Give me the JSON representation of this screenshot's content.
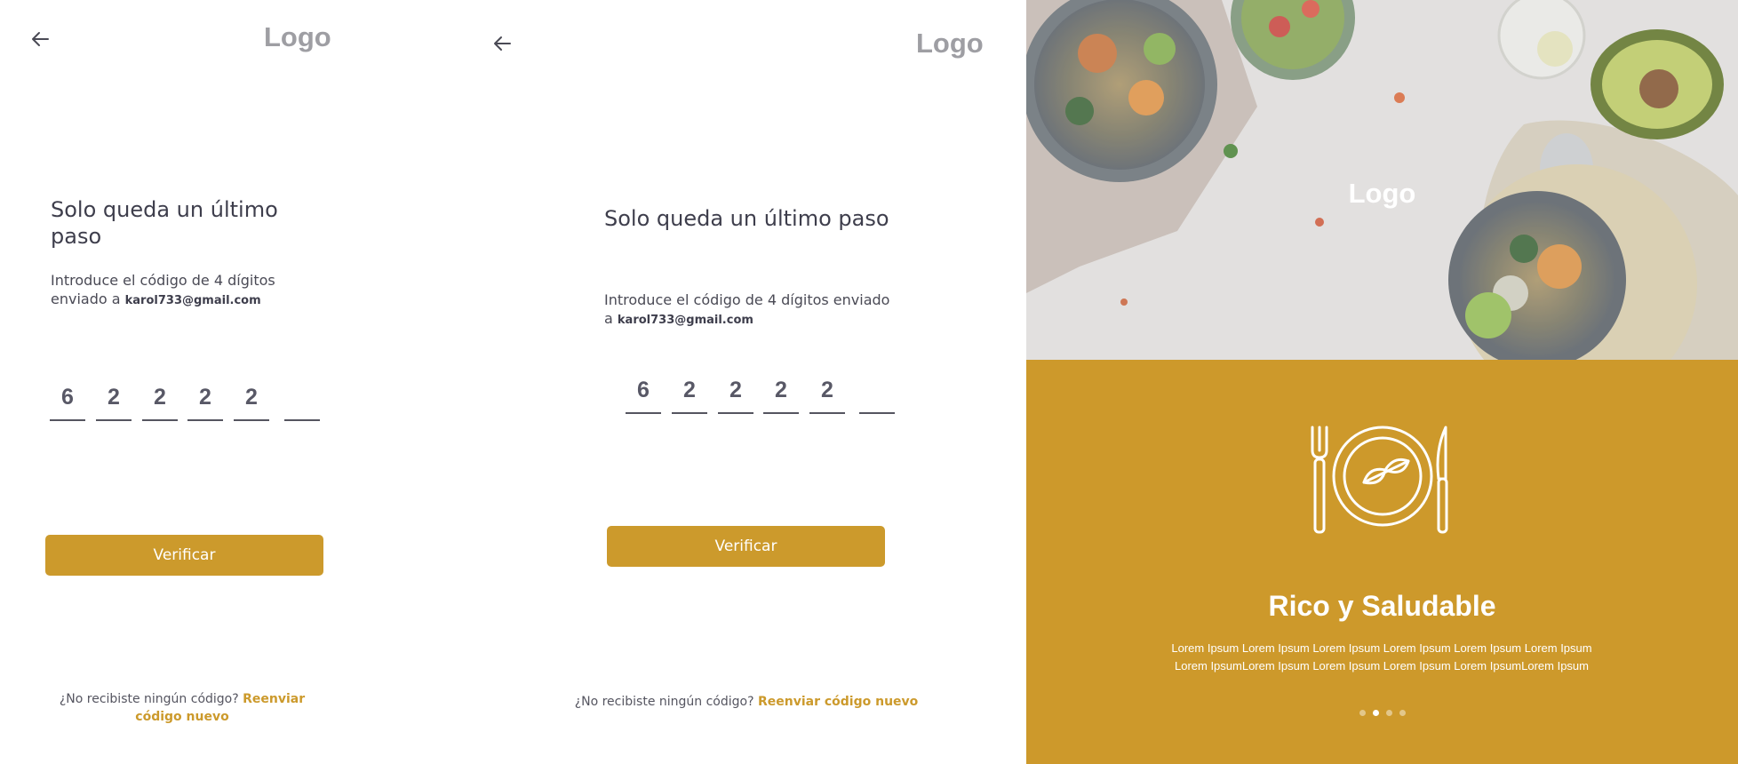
{
  "screen1": {
    "logo": "Logo",
    "title": "Solo queda un último paso",
    "instruction": "Introduce el código de 4 dígitos enviado a",
    "email": "karol733@gmail.com",
    "code_digits": [
      "6",
      "2",
      "2",
      "2",
      "2",
      ""
    ],
    "verify_label": "Verificar",
    "no_code_text": "¿No recibiste ningún código?",
    "resend_label": "Reenviar código nuevo"
  },
  "screen2": {
    "logo": "Logo",
    "title": "Solo queda un último paso",
    "instruction": "Introduce el código de 4 dígitos enviado a",
    "email": "karol733@gmail.com",
    "code_digits": [
      "6",
      "2",
      "2",
      "2",
      "2",
      ""
    ],
    "verify_label": "Verificar",
    "no_code_text": "¿No recibiste ningún código?",
    "resend_label": "Reenviar código nuevo"
  },
  "onboarding": {
    "logo": "Logo",
    "heading": "Rico y Saludable",
    "body": "Lorem Ipsum Lorem Ipsum Lorem Ipsum Lorem Ipsum Lorem Ipsum Lorem Ipsum Lorem IpsumLorem Ipsum Lorem Ipsum Lorem Ipsum Lorem IpsumLorem Ipsum",
    "pagination": {
      "total": 4,
      "active": 2
    }
  },
  "colors": {
    "accent": "#cc9a2c",
    "text_dark": "#3e3e4c",
    "logo_gray": "#9e9ea3",
    "panel_yellow": "#cd992b"
  },
  "icons": [
    "back-arrow-icon",
    "plate-cutlery-icon"
  ]
}
